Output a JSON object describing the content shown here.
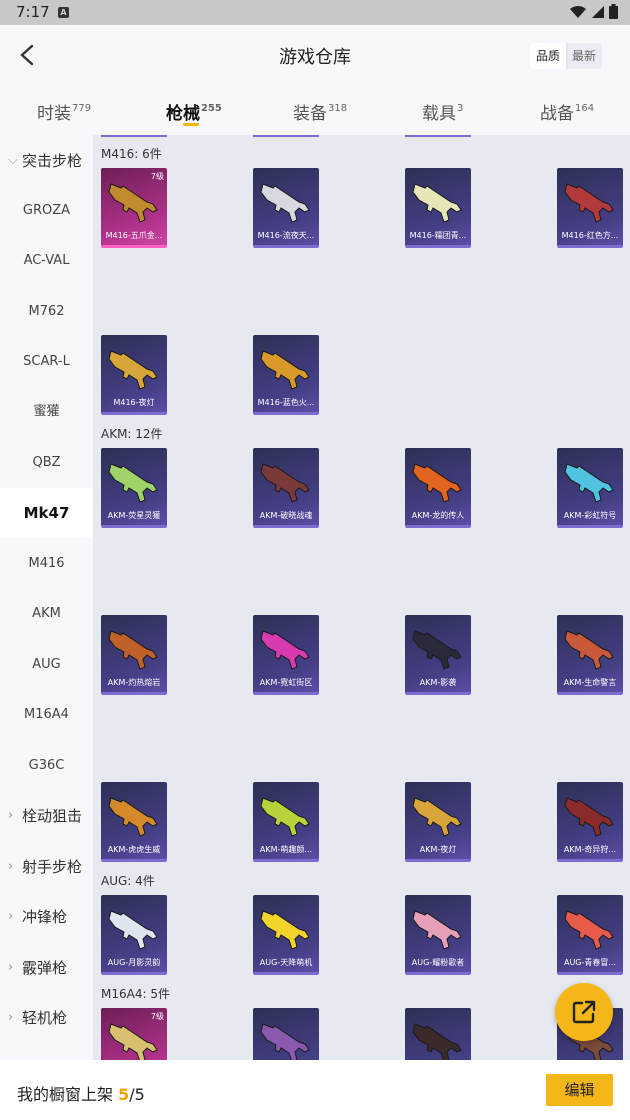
{
  "status_bar": {
    "time": "7:17",
    "notif_letter": "A"
  },
  "header": {
    "title": "游戏仓库",
    "sort_quality": "品质",
    "sort_latest": "最新"
  },
  "tabs": [
    {
      "label": "时装",
      "count": "779"
    },
    {
      "label": "枪械",
      "count": "255"
    },
    {
      "label": "装备",
      "count": "318"
    },
    {
      "label": "载具",
      "count": "3"
    },
    {
      "label": "战备",
      "count": "164"
    }
  ],
  "sidebar": {
    "items": [
      {
        "label": "突击步枪",
        "type": "category",
        "expanded": true
      },
      {
        "label": "GROZA"
      },
      {
        "label": "AC-VAL"
      },
      {
        "label": "M762"
      },
      {
        "label": "SCAR-L"
      },
      {
        "label": "蜜獾"
      },
      {
        "label": "QBZ"
      },
      {
        "label": "Mk47",
        "active": true
      },
      {
        "label": "M416"
      },
      {
        "label": "AKM"
      },
      {
        "label": "AUG"
      },
      {
        "label": "M16A4"
      },
      {
        "label": "G36C"
      },
      {
        "label": "栓动狙击",
        "type": "category"
      },
      {
        "label": "射手步枪",
        "type": "category"
      },
      {
        "label": "冲锋枪",
        "type": "category"
      },
      {
        "label": "霰弹枪",
        "type": "category"
      },
      {
        "label": "轻机枪",
        "type": "category"
      }
    ]
  },
  "groups": [
    {
      "label": "M416: 6件",
      "items": [
        {
          "name": "M416-五爪金...",
          "level": "7级",
          "gun_color": "#c28a2e"
        },
        {
          "name": "M416-流夜天...",
          "gun_color": "#d8d8e0"
        },
        {
          "name": "M416-糯团青...",
          "gun_color": "#e6e6b8"
        },
        {
          "name": "M416-红色方...",
          "gun_color": "#b23a3a"
        },
        {
          "name": "M416-夜灯",
          "gun_color": "#d7a53a"
        },
        {
          "name": "M416-蓝色火...",
          "gun_color": "#d99a2b"
        }
      ]
    },
    {
      "label": "AKM: 12件",
      "items": [
        {
          "name": "AKM-荧星灵獾",
          "gun_color": "#9fd36a"
        },
        {
          "name": "AKM-破晓战魂",
          "gun_color": "#7a3a3a"
        },
        {
          "name": "AKM-龙的传人",
          "gun_color": "#e2641d"
        },
        {
          "name": "AKM-彩虹符号",
          "gun_color": "#4fc3e0"
        },
        {
          "name": "AKM-灼热熔岩",
          "gun_color": "#c0602a"
        },
        {
          "name": "AKM-霓虹街区",
          "gun_color": "#d83ab0"
        },
        {
          "name": "AKM-影袭",
          "gun_color": "#2a2a3a"
        },
        {
          "name": "AKM-生命警言",
          "gun_color": "#c85a3a"
        },
        {
          "name": "AKM-虎虎生威",
          "gun_color": "#d48a2a"
        },
        {
          "name": "AKM-萌趣颜...",
          "gun_color": "#b8d23a"
        },
        {
          "name": "AKM-夜灯",
          "gun_color": "#d7a53a"
        },
        {
          "name": "AKM-奇异狩...",
          "gun_color": "#8a2a2a"
        }
      ]
    },
    {
      "label": "AUG: 4件",
      "items": [
        {
          "name": "AUG-月影灵韵",
          "gun_color": "#dfe6f0"
        },
        {
          "name": "AUG-天降萌机",
          "gun_color": "#f2d42a"
        },
        {
          "name": "AUG-耀粉歌者",
          "gun_color": "#e7a0b8"
        },
        {
          "name": "AUG-青春冒...",
          "gun_color": "#e85a4a"
        }
      ]
    },
    {
      "label": "M16A4: 5件",
      "items": [
        {
          "name": "",
          "level": "7级",
          "gun_color": "#d8c070"
        },
        {
          "name": "",
          "gun_color": "#8a5ab0"
        },
        {
          "name": "",
          "gun_color": "#3a2a2a"
        },
        {
          "name": "",
          "gun_color": "#7a4a3a"
        }
      ]
    }
  ],
  "footer": {
    "showcase_label": "我的橱窗上架",
    "used": "5",
    "separator": "/",
    "total": "5",
    "edit_label": "编辑"
  },
  "colors": {
    "accent": "#f5b617",
    "legendary": "#cd45a2",
    "epic": "#5b4ea6"
  }
}
